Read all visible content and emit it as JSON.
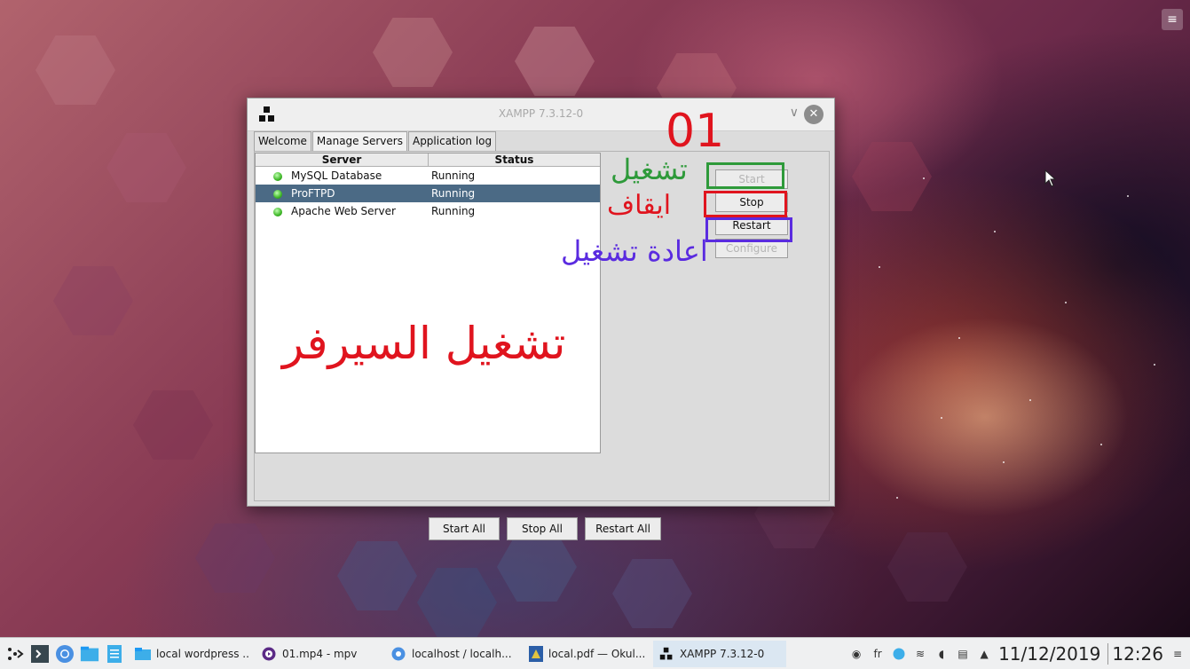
{
  "window": {
    "title": "XAMPP 7.3.12-0",
    "tabs": [
      "Welcome",
      "Manage Servers",
      "Application log"
    ],
    "active_tab": "Manage Servers"
  },
  "table": {
    "headers": [
      "Server",
      "Status"
    ],
    "rows": [
      {
        "name": "MySQL Database",
        "status": "Running"
      },
      {
        "name": "ProFTPD",
        "status": "Running"
      },
      {
        "name": "Apache Web Server",
        "status": "Running"
      }
    ],
    "selected_row": "ProFTPD"
  },
  "buttons": {
    "start": "Start",
    "stop": "Stop",
    "restart": "Restart",
    "configure": "Configure",
    "start_all": "Start All",
    "stop_all": "Stop All",
    "restart_all": "Restart All"
  },
  "annotations": {
    "step": "01",
    "start_ar": "تشغيل",
    "stop_ar": "ايقاف",
    "restart_ar": "اعادة تشغيل",
    "server_start_ar": "تشغيل السيرفر",
    "colors": {
      "green": "#2e9a3a",
      "red": "#e0141e",
      "purple": "#5a2be0"
    }
  },
  "taskbar": {
    "tasks": [
      {
        "label": "local wordpress ...",
        "icon": "folder-icon"
      },
      {
        "label": "01.mp4 - mpv",
        "icon": "mpv-icon"
      },
      {
        "label": "localhost / localh...",
        "icon": "chromium-icon"
      },
      {
        "label": "local.pdf — Okul...",
        "icon": "okular-icon"
      },
      {
        "label": "XAMPP 7.3.12-0",
        "icon": "xampp-icon"
      }
    ],
    "keyboard_layout": "fr",
    "date": "11/12/2019",
    "time": "12:26"
  }
}
